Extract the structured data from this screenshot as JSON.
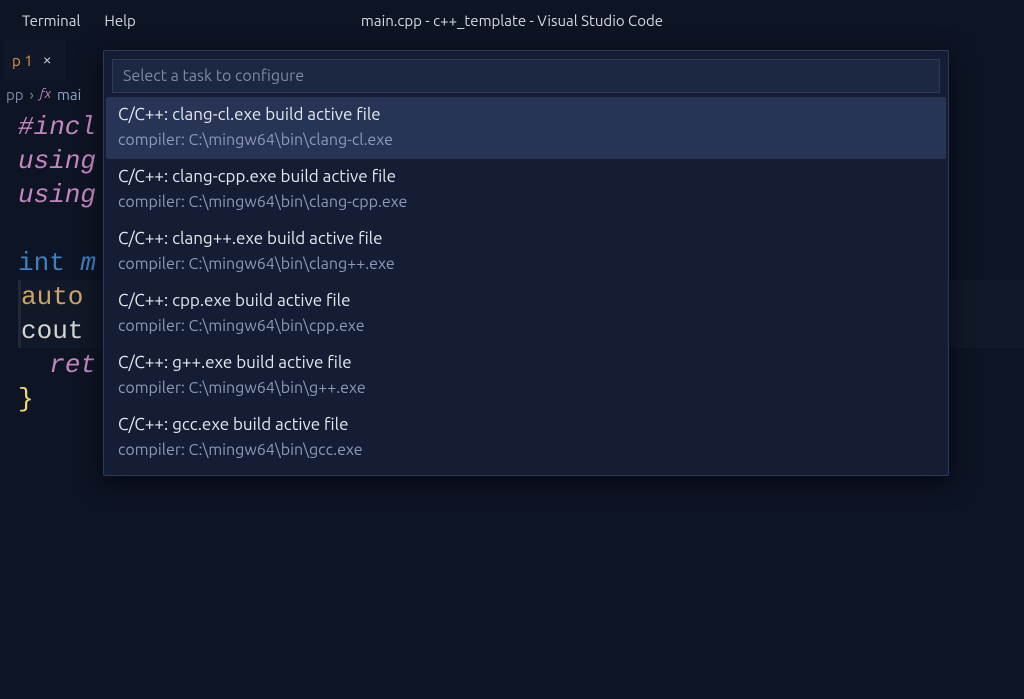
{
  "menu": {
    "terminal": "Terminal",
    "help": "Help"
  },
  "window_title": "main.cpp - c++_template - Visual Studio Code",
  "tab": {
    "label_fragment": "p 1",
    "close_glyph": "×"
  },
  "breadcrumb": {
    "file_fragment": "pp",
    "sep_glyph": "›",
    "fn_icon_text": "ƒx",
    "fn_fragment": "mai"
  },
  "editor": {
    "lines": [
      {
        "raw": [
          {
            "cls": "tok-keyword",
            "t": "#incl"
          }
        ]
      },
      {
        "raw": [
          {
            "cls": "tok-keyword",
            "t": "using"
          }
        ]
      },
      {
        "raw": [
          {
            "cls": "tok-keyword",
            "t": "using"
          }
        ]
      },
      {
        "raw": []
      },
      {
        "raw": [
          {
            "cls": "tok-type",
            "t": "int"
          },
          {
            "cls": "tok-ident",
            "t": " "
          },
          {
            "cls": "tok-typeital",
            "t": "m"
          }
        ]
      },
      {
        "hl": true,
        "raw": [
          {
            "cls": "tok-auto",
            "t": "auto"
          },
          {
            "cls": "tok-ident",
            "t": " "
          }
        ]
      },
      {
        "hl": true,
        "raw": [
          {
            "cls": "tok-ident",
            "t": "cout "
          }
        ]
      },
      {
        "raw": [
          {
            "cls": "tok-ident",
            "t": "  "
          },
          {
            "cls": "tok-retital",
            "t": "ret"
          }
        ]
      },
      {
        "raw": [
          {
            "cls": "tok-brace",
            "t": "}"
          }
        ]
      }
    ]
  },
  "quickpick": {
    "placeholder": "Select a task to configure",
    "items": [
      {
        "title": "C/C++: clang-cl.exe build active file",
        "desc": "compiler: C:\\mingw64\\bin\\clang-cl.exe",
        "selected": true
      },
      {
        "title": "C/C++: clang-cpp.exe build active file",
        "desc": "compiler: C:\\mingw64\\bin\\clang-cpp.exe",
        "selected": false
      },
      {
        "title": "C/C++: clang++.exe build active file",
        "desc": "compiler: C:\\mingw64\\bin\\clang++.exe",
        "selected": false
      },
      {
        "title": "C/C++: cpp.exe build active file",
        "desc": "compiler: C:\\mingw64\\bin\\cpp.exe",
        "selected": false
      },
      {
        "title": "C/C++: g++.exe build active file",
        "desc": "compiler: C:\\mingw64\\bin\\g++.exe",
        "selected": false
      },
      {
        "title": "C/C++: gcc.exe build active file",
        "desc": "compiler: C:\\mingw64\\bin\\gcc.exe",
        "selected": false
      }
    ]
  }
}
